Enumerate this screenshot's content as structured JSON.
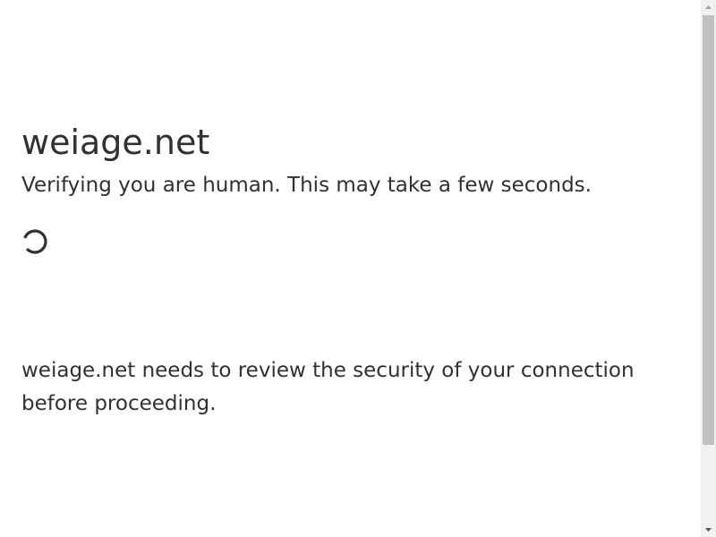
{
  "page": {
    "domain_title": "weiage.net",
    "subtitle": "Verifying you are human. This may take a few seconds.",
    "security_message": "weiage.net needs to review the security of your connection before proceeding."
  },
  "spinner": {
    "icon": "loading-spinner-icon",
    "color": "#313131"
  },
  "scrollbar": {
    "track_color": "#f1f1f1",
    "thumb_color": "#c1c1c1"
  },
  "colors": {
    "background": "#ffffff",
    "text": "#313131"
  }
}
